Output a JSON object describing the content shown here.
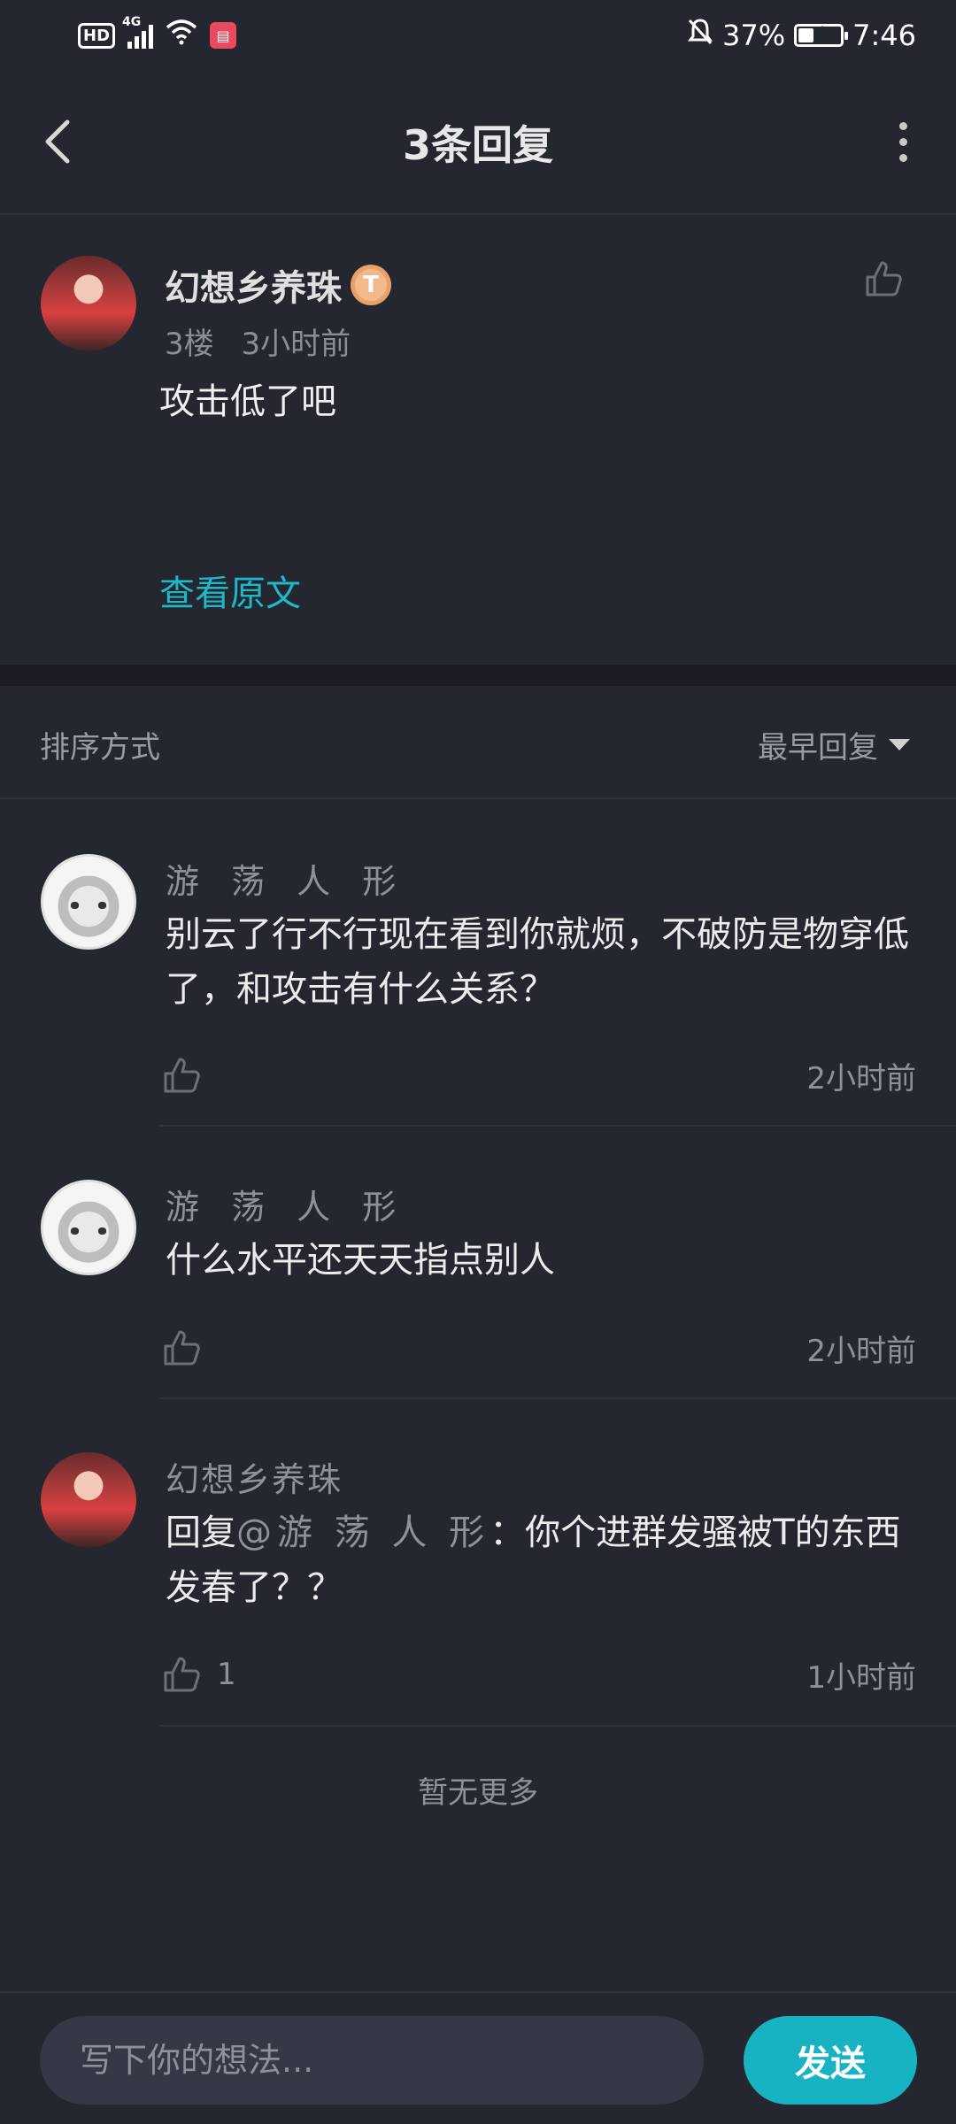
{
  "status_bar": {
    "hd": "HD",
    "network": "4G",
    "battery_percent": "37%",
    "battery_level": 0.37,
    "time": "7:46"
  },
  "header": {
    "title": "3条回复"
  },
  "main_post": {
    "author": "幻想乡养珠",
    "level_badge": "T",
    "floor": "3楼",
    "time": "3小时前",
    "content": "攻击低了吧",
    "view_original": "查看原文"
  },
  "sort": {
    "label": "排序方式",
    "selected": "最早回复"
  },
  "replies": [
    {
      "author": "游 荡 人 形",
      "text": "别云了行不行现在看到你就烦，不破防是物穿低了，和攻击有什么关系？",
      "likes": "",
      "time": "2小时前"
    },
    {
      "author": "游 荡 人 形",
      "text": "什么水平还天天指点别人",
      "likes": "",
      "time": "2小时前"
    },
    {
      "author": "幻想乡养珠",
      "reply_prefix": "回复",
      "mention": "@游 荡 人 形",
      "text": "：你个进群发骚被T的东西发春了？？",
      "likes": "1",
      "time": "1小时前"
    }
  ],
  "footer": {
    "no_more": "暂无更多",
    "input_placeholder": "写下你的想法...",
    "send_label": "发送"
  },
  "colors": {
    "background": "#242630",
    "accent": "#17b3c3",
    "link": "#1fb8c9"
  }
}
